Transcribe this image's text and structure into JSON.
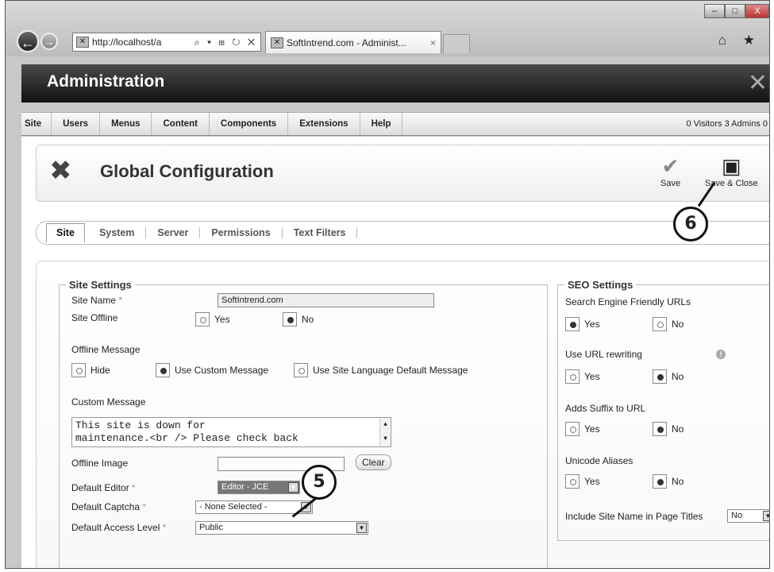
{
  "browser": {
    "url": "http://localhost/a",
    "tab_title": "SoftIntrend.com - Administ...",
    "tab_close": "×",
    "address_tools": "⌕ ▾ ⊞ ↻ ✕",
    "back": "←",
    "forward": "→",
    "right_icons": "⌂ ★",
    "win_buttons": [
      "–",
      "□",
      "X"
    ]
  },
  "header": {
    "title": "Administration"
  },
  "menu": {
    "items": [
      "Site",
      "Users",
      "Menus",
      "Content",
      "Components",
      "Extensions",
      "Help"
    ],
    "status": "0 Visitors   3 Admins   0"
  },
  "page": {
    "title": "Global Configuration",
    "save": "Save",
    "save_close": "Save & Close"
  },
  "tabs": [
    "Site",
    "System",
    "Server",
    "Permissions",
    "Text Filters"
  ],
  "site_settings": {
    "legend": "Site Settings",
    "site_name_label": "Site Name",
    "site_name_value": "SoftIntrend.com",
    "site_offline_label": "Site Offline",
    "yes": "Yes",
    "no": "No",
    "offline_message_label": "Offline Message",
    "hide": "Hide",
    "use_custom": "Use Custom Message",
    "use_site_lang": "Use Site Language Default Message",
    "custom_message_label": "Custom Message",
    "custom_message_line1": "This site is down for",
    "custom_message_line2": "maintenance.<br /> Please check back",
    "offline_image_label": "Offline Image",
    "clear": "Clear",
    "default_editor_label": "Default Editor",
    "default_editor_value": "Editor - JCE",
    "default_captcha_label": "Default Captcha",
    "default_captcha_value": "- None Selected -",
    "default_access_label": "Default Access Level",
    "default_access_value": "Public",
    "required_marker": "*"
  },
  "seo_settings": {
    "legend": "SEO Settings",
    "sef_label": "Search Engine Friendly URLs",
    "rewrite_label": "Use URL rewriting",
    "suffix_label": "Adds Suffix to URL",
    "unicode_label": "Unicode Aliases",
    "include_site_name_label": "Include Site Name in Page Titles",
    "include_site_name_value": "No",
    "yes": "Yes",
    "no": "No",
    "warn": "!"
  },
  "callouts": {
    "five": "5",
    "six": "6"
  }
}
